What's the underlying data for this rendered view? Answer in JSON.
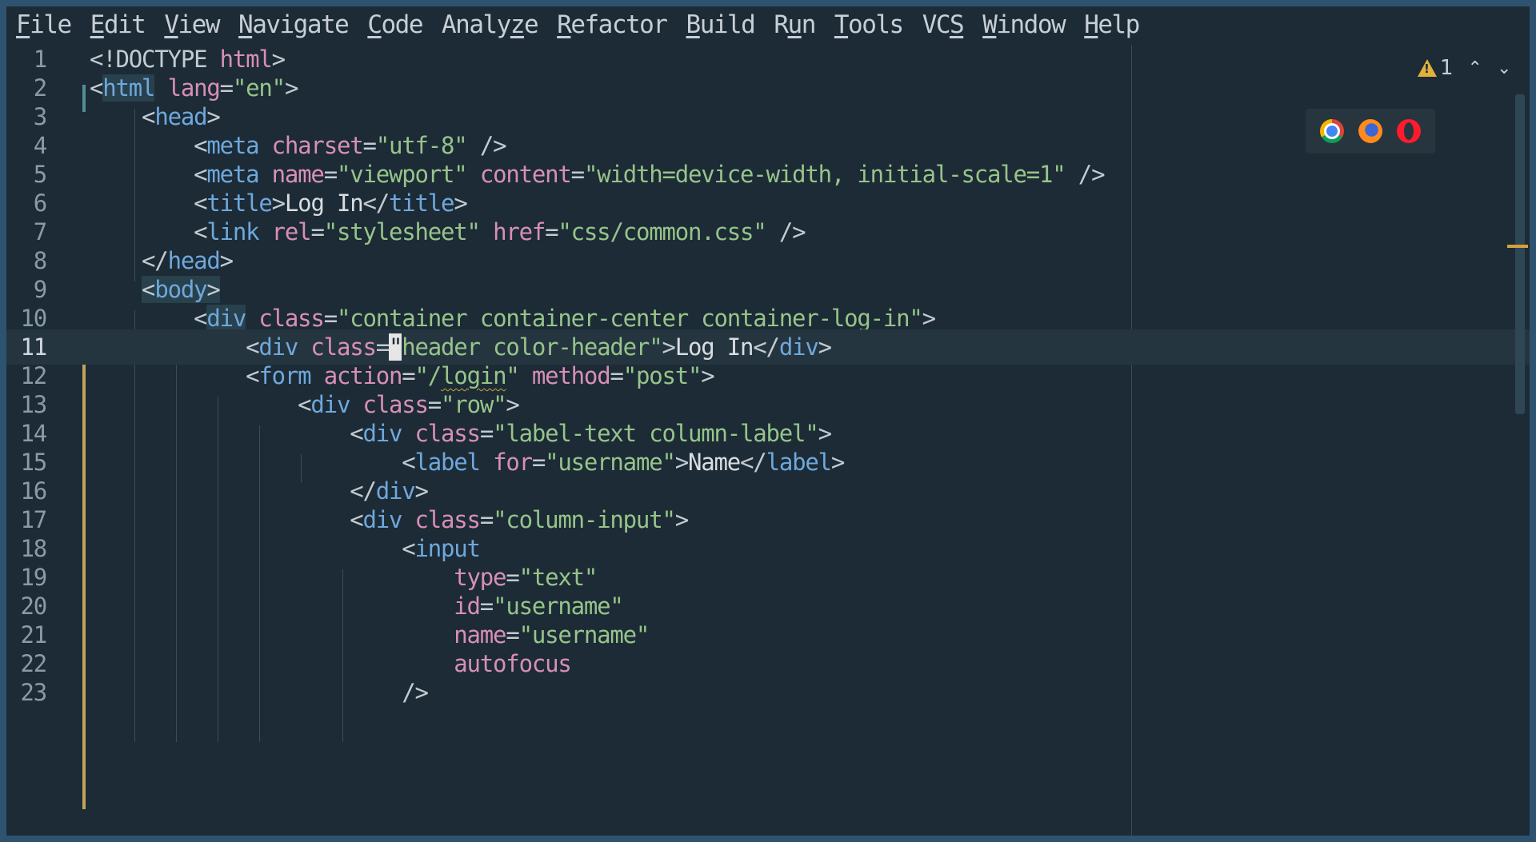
{
  "menu": [
    {
      "mnemonic": "F",
      "rest": "ile"
    },
    {
      "mnemonic": "E",
      "rest": "dit"
    },
    {
      "mnemonic": "V",
      "rest": "iew"
    },
    {
      "mnemonic": "N",
      "rest": "avigate"
    },
    {
      "mnemonic": "C",
      "rest": "ode"
    },
    {
      "pre": "Analy",
      "mnemonic": "z",
      "rest": "e"
    },
    {
      "mnemonic": "R",
      "rest": "efactor"
    },
    {
      "mnemonic": "B",
      "rest": "uild"
    },
    {
      "pre": "R",
      "mnemonic": "u",
      "rest": "n"
    },
    {
      "mnemonic": "T",
      "rest": "ools"
    },
    {
      "pre": "VC",
      "mnemonic": "S",
      "rest": ""
    },
    {
      "mnemonic": "W",
      "rest": "indow"
    },
    {
      "mnemonic": "H",
      "rest": "elp"
    }
  ],
  "inspection": {
    "warning_count": "1"
  },
  "browsers": [
    "chrome-icon",
    "firefox-icon",
    "opera-icon"
  ],
  "current_line": 11,
  "lines": [
    {
      "n": "1",
      "tokens": [
        [
          "p",
          "<!DOCTYPE "
        ],
        [
          "a",
          "html"
        ],
        [
          "p",
          ">"
        ]
      ]
    },
    {
      "n": "2",
      "tokens": [
        [
          "p",
          "<"
        ],
        [
          "th",
          "html"
        ],
        [
          "p",
          " "
        ],
        [
          "a",
          "lang"
        ],
        [
          "p",
          "="
        ],
        [
          "s",
          "\"en\""
        ],
        [
          "p",
          ">"
        ]
      ]
    },
    {
      "n": "3",
      "tokens": [
        [
          "p",
          "    <"
        ],
        [
          "t",
          "head"
        ],
        [
          "p",
          ">"
        ]
      ]
    },
    {
      "n": "4",
      "tokens": [
        [
          "p",
          "        <"
        ],
        [
          "t",
          "meta"
        ],
        [
          "p",
          " "
        ],
        [
          "a",
          "charset"
        ],
        [
          "p",
          "="
        ],
        [
          "s",
          "\"utf-8\""
        ],
        [
          "p",
          " />"
        ]
      ]
    },
    {
      "n": "5",
      "tokens": [
        [
          "p",
          "        <"
        ],
        [
          "t",
          "meta"
        ],
        [
          "p",
          " "
        ],
        [
          "a",
          "name"
        ],
        [
          "p",
          "="
        ],
        [
          "s",
          "\"viewport\""
        ],
        [
          "p",
          " "
        ],
        [
          "a",
          "content"
        ],
        [
          "p",
          "="
        ],
        [
          "s",
          "\"width=device-width, initial-scale=1\""
        ],
        [
          "p",
          " />"
        ]
      ]
    },
    {
      "n": "6",
      "tokens": [
        [
          "p",
          "        <"
        ],
        [
          "t",
          "title"
        ],
        [
          "p",
          ">"
        ],
        [
          "x",
          "Log In"
        ],
        [
          "p",
          "</"
        ],
        [
          "t",
          "title"
        ],
        [
          "p",
          ">"
        ]
      ]
    },
    {
      "n": "7",
      "tokens": [
        [
          "p",
          "        <"
        ],
        [
          "t",
          "link"
        ],
        [
          "p",
          " "
        ],
        [
          "a",
          "rel"
        ],
        [
          "p",
          "="
        ],
        [
          "s",
          "\"stylesheet\""
        ],
        [
          "p",
          " "
        ],
        [
          "a",
          "href"
        ],
        [
          "p",
          "="
        ],
        [
          "s",
          "\"css/common.css\""
        ],
        [
          "p",
          " />"
        ]
      ]
    },
    {
      "n": "8",
      "tokens": [
        [
          "p",
          "    </"
        ],
        [
          "t",
          "head"
        ],
        [
          "p",
          ">"
        ]
      ]
    },
    {
      "n": "9",
      "tokens": [
        [
          "p",
          "    "
        ],
        [
          "hp",
          "<"
        ],
        [
          "th",
          "body"
        ],
        [
          "hp",
          ">"
        ]
      ]
    },
    {
      "n": "10",
      "tokens": [
        [
          "p",
          "        <"
        ],
        [
          "th",
          "div"
        ],
        [
          "p",
          " "
        ],
        [
          "a",
          "class"
        ],
        [
          "p",
          "="
        ],
        [
          "s",
          "\"container container-center container-log-in\""
        ],
        [
          "p",
          ">"
        ]
      ]
    },
    {
      "n": "11",
      "tokens": [
        [
          "p",
          "            <"
        ],
        [
          "t",
          "div"
        ],
        [
          "p",
          " "
        ],
        [
          "a",
          "class"
        ],
        [
          "p",
          "="
        ],
        [
          "c",
          "\""
        ],
        [
          "s",
          "header color-header\""
        ],
        [
          "p",
          ">"
        ],
        [
          "x",
          "Log In"
        ],
        [
          "p",
          "</"
        ],
        [
          "t",
          "div"
        ],
        [
          "p",
          ">"
        ]
      ]
    },
    {
      "n": "12",
      "tokens": [
        [
          "p",
          "            <"
        ],
        [
          "t",
          "form"
        ],
        [
          "p",
          " "
        ],
        [
          "a",
          "action"
        ],
        [
          "p",
          "="
        ],
        [
          "s",
          "\"/"
        ],
        [
          "w",
          "login"
        ],
        [
          "s",
          "\""
        ],
        [
          "p",
          " "
        ],
        [
          "a",
          "method"
        ],
        [
          "p",
          "="
        ],
        [
          "s",
          "\"post\""
        ],
        [
          "p",
          ">"
        ]
      ]
    },
    {
      "n": "13",
      "tokens": [
        [
          "p",
          "                <"
        ],
        [
          "t",
          "div"
        ],
        [
          "p",
          " "
        ],
        [
          "a",
          "class"
        ],
        [
          "p",
          "="
        ],
        [
          "s",
          "\"row\""
        ],
        [
          "p",
          ">"
        ]
      ]
    },
    {
      "n": "14",
      "tokens": [
        [
          "p",
          "                    <"
        ],
        [
          "t",
          "div"
        ],
        [
          "p",
          " "
        ],
        [
          "a",
          "class"
        ],
        [
          "p",
          "="
        ],
        [
          "s",
          "\"label-text column-label\""
        ],
        [
          "p",
          ">"
        ]
      ]
    },
    {
      "n": "15",
      "tokens": [
        [
          "p",
          "                        <"
        ],
        [
          "t",
          "label"
        ],
        [
          "p",
          " "
        ],
        [
          "a",
          "for"
        ],
        [
          "p",
          "="
        ],
        [
          "s",
          "\"username\""
        ],
        [
          "p",
          ">"
        ],
        [
          "x",
          "Name"
        ],
        [
          "p",
          "</"
        ],
        [
          "t",
          "label"
        ],
        [
          "p",
          ">"
        ]
      ]
    },
    {
      "n": "16",
      "tokens": [
        [
          "p",
          "                    </"
        ],
        [
          "t",
          "div"
        ],
        [
          "p",
          ">"
        ]
      ]
    },
    {
      "n": "17",
      "tokens": [
        [
          "p",
          "                    <"
        ],
        [
          "t",
          "div"
        ],
        [
          "p",
          " "
        ],
        [
          "a",
          "class"
        ],
        [
          "p",
          "="
        ],
        [
          "s",
          "\"column-input\""
        ],
        [
          "p",
          ">"
        ]
      ]
    },
    {
      "n": "18",
      "tokens": [
        [
          "p",
          "                        <"
        ],
        [
          "t",
          "input"
        ]
      ]
    },
    {
      "n": "19",
      "tokens": [
        [
          "p",
          "                            "
        ],
        [
          "a",
          "type"
        ],
        [
          "p",
          "="
        ],
        [
          "s",
          "\"text\""
        ]
      ]
    },
    {
      "n": "20",
      "tokens": [
        [
          "p",
          "                            "
        ],
        [
          "a",
          "id"
        ],
        [
          "p",
          "="
        ],
        [
          "s",
          "\"username\""
        ]
      ]
    },
    {
      "n": "21",
      "tokens": [
        [
          "p",
          "                            "
        ],
        [
          "a",
          "name"
        ],
        [
          "p",
          "="
        ],
        [
          "s",
          "\"username\""
        ]
      ]
    },
    {
      "n": "22",
      "tokens": [
        [
          "p",
          "                            "
        ],
        [
          "a",
          "autofocus"
        ]
      ]
    },
    {
      "n": "23",
      "tokens": [
        [
          "p",
          "                        />"
        ]
      ]
    }
  ],
  "colors": {
    "background": "#1c2b36",
    "frame": "#2e5370",
    "tag": "#6fa8dc",
    "attribute": "#d88fb7",
    "string": "#97c48a",
    "warning": "#e1b13c"
  }
}
